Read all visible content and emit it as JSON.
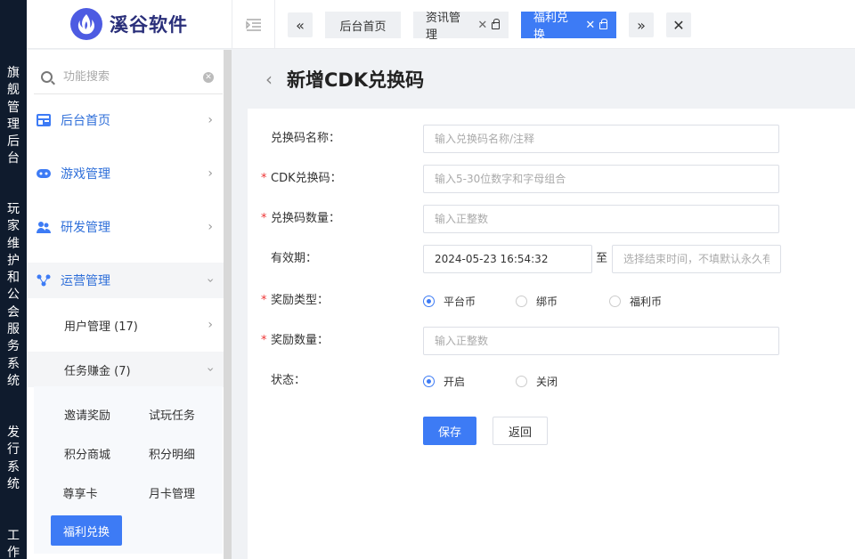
{
  "vnav": [
    {
      "label": "旗舰管理后台",
      "chars": [
        "旗",
        "舰",
        "管",
        "理",
        "后",
        "台"
      ]
    },
    {
      "label": "玩家维护和公会服务系统",
      "chars": [
        "玩",
        "家",
        "维",
        "护",
        "和",
        "公",
        "会",
        "服",
        "务",
        "系",
        "统"
      ]
    },
    {
      "label": "发行系统",
      "chars": [
        "发",
        "行",
        "系",
        "统"
      ]
    },
    {
      "label": "工作",
      "chars": [
        "工",
        "作"
      ]
    }
  ],
  "logo": {
    "text": "溪谷软件"
  },
  "topbar": {
    "tabs": [
      {
        "label": "后台首页"
      },
      {
        "label": "资讯管理",
        "close": "✕"
      },
      {
        "label": "福利兑换",
        "close": "✕"
      }
    ]
  },
  "sidebar": {
    "search_placeholder": "功能搜索",
    "menu": [
      {
        "label": "后台首页"
      },
      {
        "label": "游戏管理"
      },
      {
        "label": "研发管理"
      },
      {
        "label": "运营管理"
      }
    ],
    "sub": [
      {
        "label": "用户管理 (17)"
      },
      {
        "label": "任务赚金 (7)"
      }
    ],
    "leaves": [
      {
        "label": "邀请奖励"
      },
      {
        "label": "试玩任务"
      },
      {
        "label": "积分商城"
      },
      {
        "label": "积分明细"
      },
      {
        "label": "尊享卡"
      },
      {
        "label": "月卡管理"
      },
      {
        "label": "福利兑换"
      }
    ]
  },
  "page": {
    "title": "新增CDK兑换码",
    "form": {
      "name_label": "兑换码名称：",
      "name_placeholder": "输入兑换码名称/注释",
      "cdk_label": "CDK兑换码：",
      "cdk_placeholder": "输入5-30位数字和字母组合",
      "qty_label": "兑换码数量：",
      "qty_placeholder": "输入正整数",
      "validity_label": "有效期：",
      "validity_start": "2024-05-23 16:54:32",
      "validity_sep": "至",
      "validity_end_placeholder": "选择结束时间，不填默认永久有效",
      "reward_type_label": "奖励类型：",
      "reward_types": [
        "平台币",
        "绑币",
        "福利币"
      ],
      "reward_qty_label": "奖励数量：",
      "reward_qty_placeholder": "输入正整数",
      "status_label": "状态：",
      "status_options": [
        "开启",
        "关闭"
      ],
      "required_mark": "*",
      "save": "保存",
      "back": "返回"
    }
  },
  "colors": {
    "accent": "#3d7bf5",
    "nav_bg": "#0f1b2d",
    "logo_text": "#2a2f7a"
  }
}
